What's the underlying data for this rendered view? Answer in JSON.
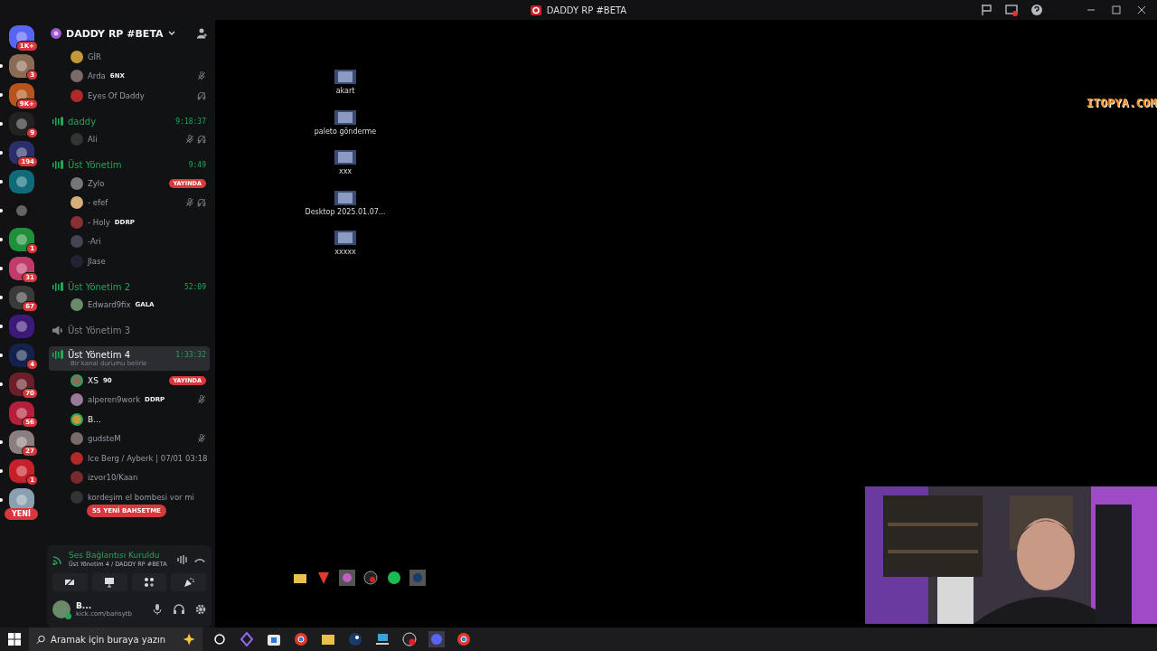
{
  "window": {
    "title": "DADDY RP #BETA"
  },
  "servers": [
    {
      "badge": "1K+",
      "unread": false
    },
    {
      "badge": "3",
      "unread": true
    },
    {
      "badge": "9K+",
      "unread": true
    },
    {
      "badge": "9",
      "unread": true
    },
    {
      "badge": "194",
      "unread": true
    },
    {
      "unread": true
    },
    {
      "unread": true
    },
    {
      "badge": "1",
      "unread": true
    },
    {
      "badge": "31",
      "unread": true
    },
    {
      "badge": "67",
      "unread": true
    },
    {
      "unread": true
    },
    {
      "badge": "4",
      "unread": true
    },
    {
      "badge": "70",
      "unread": true
    },
    {
      "badge": "56",
      "unread": false
    },
    {
      "badge": "27",
      "unread": true
    },
    {
      "badge": "1",
      "unread": true
    },
    {
      "unread": true
    }
  ],
  "new_button": "YENİ",
  "server_header": {
    "name": "DADDY RP #BETA"
  },
  "rows": [
    {
      "kind": "user",
      "name": "GİR"
    },
    {
      "kind": "user",
      "name": "Arda",
      "tag": "6NX",
      "muted": true
    },
    {
      "kind": "user",
      "name": "Eyes Of Daddy",
      "deafened": true
    },
    {
      "kind": "channel",
      "name": "daddy",
      "time": "9:18:37",
      "active": true,
      "selected": false
    },
    {
      "kind": "user",
      "name": "Ali",
      "muted": true,
      "deafened": true
    },
    {
      "kind": "channel",
      "name": "Üst Yönetim",
      "time": "9:49",
      "active": true,
      "selected": false
    },
    {
      "kind": "user",
      "name": "Zylo",
      "live": "YAYINDA"
    },
    {
      "kind": "user",
      "name": "- efef",
      "muted": true,
      "deafened": true
    },
    {
      "kind": "user",
      "name": "- Holy",
      "tag": "DDRP"
    },
    {
      "kind": "user",
      "name": "-Ari"
    },
    {
      "kind": "user",
      "name": "Jlase"
    },
    {
      "kind": "channel",
      "name": "Üst Yönetim 2",
      "time": "52:09",
      "active": true,
      "selected": false
    },
    {
      "kind": "user",
      "name": "Edward9fix",
      "tag": "GALA"
    },
    {
      "kind": "channel",
      "name": "Üst Yönetim 3",
      "active": false,
      "selected": false
    },
    {
      "kind": "channel",
      "name": "Üst Yönetim 4",
      "time": "1:33:32",
      "status": "Bir kanal durumu belirle",
      "active": true,
      "selected": true
    },
    {
      "kind": "user",
      "name": "XS",
      "tag": "90",
      "live": "YAYINDA",
      "speaking": true
    },
    {
      "kind": "user",
      "name": "alperen9work",
      "tag": "DDRP",
      "muted": true
    },
    {
      "kind": "user",
      "name": "B...",
      "speaking": true
    },
    {
      "kind": "user",
      "name": "gudsteM",
      "muted": true
    },
    {
      "kind": "user",
      "name": "Ice Berg / Ayberk | 07/01 03:18"
    },
    {
      "kind": "user",
      "name": "izvor10/Kaan"
    },
    {
      "kind": "user",
      "name": "kordeşim el bombesi vor mi"
    }
  ],
  "mentions_pill": "55 YENİ BAHSETME",
  "voice_panel": {
    "status": "Ses Bağlantısı Kuruldu",
    "channel": "Üst Yönetim 4 / DADDY RP #BETA"
  },
  "user_panel": {
    "name": "B...",
    "status": "kick.com/barisytb"
  },
  "desktop_icons": [
    {
      "label": "akart"
    },
    {
      "label": "paleto gönderme"
    },
    {
      "label": "xxx"
    },
    {
      "label": "Desktop 2025.01.07..."
    },
    {
      "label": "xxxxx"
    }
  ],
  "overlay_logo": "ITOPYA.COM",
  "taskbar": {
    "search_placeholder": "Aramak için buraya yazın"
  }
}
